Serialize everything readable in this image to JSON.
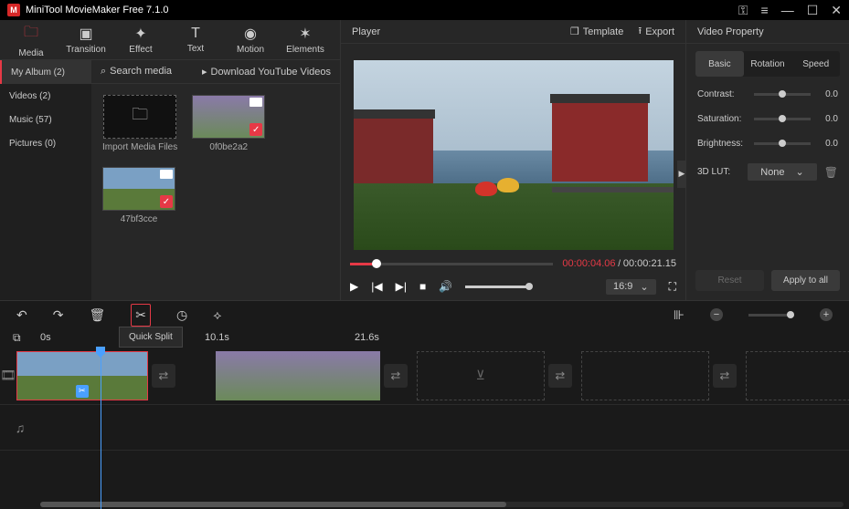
{
  "app": {
    "title": "MiniTool MovieMaker Free 7.1.0"
  },
  "tabs": {
    "media": "Media",
    "transition": "Transition",
    "effect": "Effect",
    "text": "Text",
    "motion": "Motion",
    "elements": "Elements"
  },
  "sidebar": {
    "album": "My Album (2)",
    "videos": "Videos (2)",
    "music": "Music (57)",
    "pictures": "Pictures (0)"
  },
  "contenthead": {
    "search": "Search media",
    "yt": "Download YouTube Videos"
  },
  "thumbs": {
    "import": "Import Media Files",
    "t1": "0f0be2a2",
    "t2": "47bf3cce"
  },
  "player": {
    "title": "Player",
    "template": "Template",
    "export": "Export",
    "cur": "00:00:04.06",
    "dur": "00:00:21.15",
    "ratio": "16:9"
  },
  "props": {
    "title": "Video Property",
    "basic": "Basic",
    "rotation": "Rotation",
    "speed": "Speed",
    "contrast": "Contrast:",
    "saturation": "Saturation:",
    "brightness": "Brightness:",
    "lut": "3D LUT:",
    "val": "0.0",
    "none": "None",
    "reset": "Reset",
    "apply": "Apply to all"
  },
  "tooltip": "Quick Split",
  "ruler": {
    "t0": "0s",
    "t1": "10.1s",
    "t2": "21.6s"
  }
}
